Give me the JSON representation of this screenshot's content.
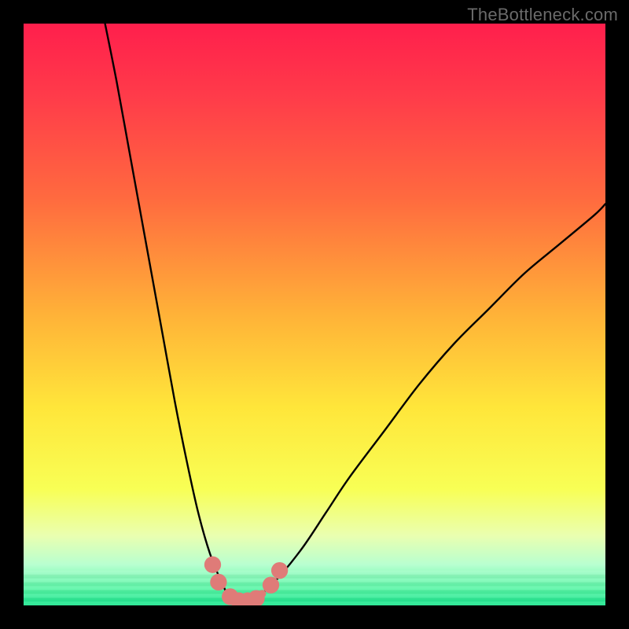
{
  "watermark": "TheBottleneck.com",
  "chart_data": {
    "type": "line",
    "title": "",
    "xlabel": "",
    "ylabel": "",
    "xlim": [
      0,
      100
    ],
    "ylim": [
      0,
      100
    ],
    "grid": false,
    "legend": false,
    "series": [
      {
        "name": "left-branch",
        "x": [
          14,
          16,
          18,
          20,
          22,
          24,
          26,
          28,
          30,
          32,
          34,
          35
        ],
        "y": [
          100,
          90,
          79,
          68,
          57,
          46,
          35,
          25,
          16,
          9,
          4,
          2
        ],
        "color": "#000000"
      },
      {
        "name": "right-branch",
        "x": [
          41,
          44,
          48,
          52,
          56,
          62,
          68,
          74,
          80,
          86,
          92,
          98,
          100
        ],
        "y": [
          2,
          5,
          10,
          16,
          22,
          30,
          38,
          45,
          51,
          57,
          62,
          67,
          69
        ],
        "color": "#000000"
      },
      {
        "name": "valley-floor",
        "x": [
          35,
          36,
          37,
          38,
          39,
          40,
          41
        ],
        "y": [
          2,
          1,
          0.6,
          0.5,
          0.6,
          1,
          2
        ],
        "color": "#000000"
      }
    ],
    "markers": [
      {
        "name": "left-marker-upper",
        "x": 32.5,
        "y": 7,
        "r": 1.6,
        "color": "#df7b78"
      },
      {
        "name": "left-marker-lower",
        "x": 33.5,
        "y": 4,
        "r": 1.6,
        "color": "#df7b78"
      },
      {
        "name": "floor-marker-1",
        "x": 35.5,
        "y": 1.5,
        "r": 1.6,
        "color": "#df7b78"
      },
      {
        "name": "floor-marker-2",
        "x": 37.0,
        "y": 0.8,
        "r": 1.6,
        "color": "#df7b78"
      },
      {
        "name": "floor-marker-3",
        "x": 38.5,
        "y": 0.8,
        "r": 1.6,
        "color": "#df7b78"
      },
      {
        "name": "floor-marker-4",
        "x": 40.0,
        "y": 1.2,
        "r": 1.6,
        "color": "#df7b78"
      },
      {
        "name": "right-marker-lower",
        "x": 42.5,
        "y": 3.5,
        "r": 1.6,
        "color": "#df7b78"
      },
      {
        "name": "right-marker-upper",
        "x": 44.0,
        "y": 6,
        "r": 1.6,
        "color": "#df7b78"
      }
    ],
    "gradient_stops": [
      {
        "offset": 0.0,
        "color": "#ff1f4c"
      },
      {
        "offset": 0.12,
        "color": "#ff3a4a"
      },
      {
        "offset": 0.3,
        "color": "#ff6a3f"
      },
      {
        "offset": 0.5,
        "color": "#ffb238"
      },
      {
        "offset": 0.66,
        "color": "#ffe63a"
      },
      {
        "offset": 0.8,
        "color": "#f8ff55"
      },
      {
        "offset": 0.88,
        "color": "#eaffb0"
      },
      {
        "offset": 0.93,
        "color": "#b8ffd0"
      },
      {
        "offset": 0.97,
        "color": "#5cf7a8"
      },
      {
        "offset": 1.0,
        "color": "#17e58c"
      }
    ],
    "bottom_band": {
      "from_y": 0,
      "to_y": 6,
      "stripes": 10
    }
  }
}
